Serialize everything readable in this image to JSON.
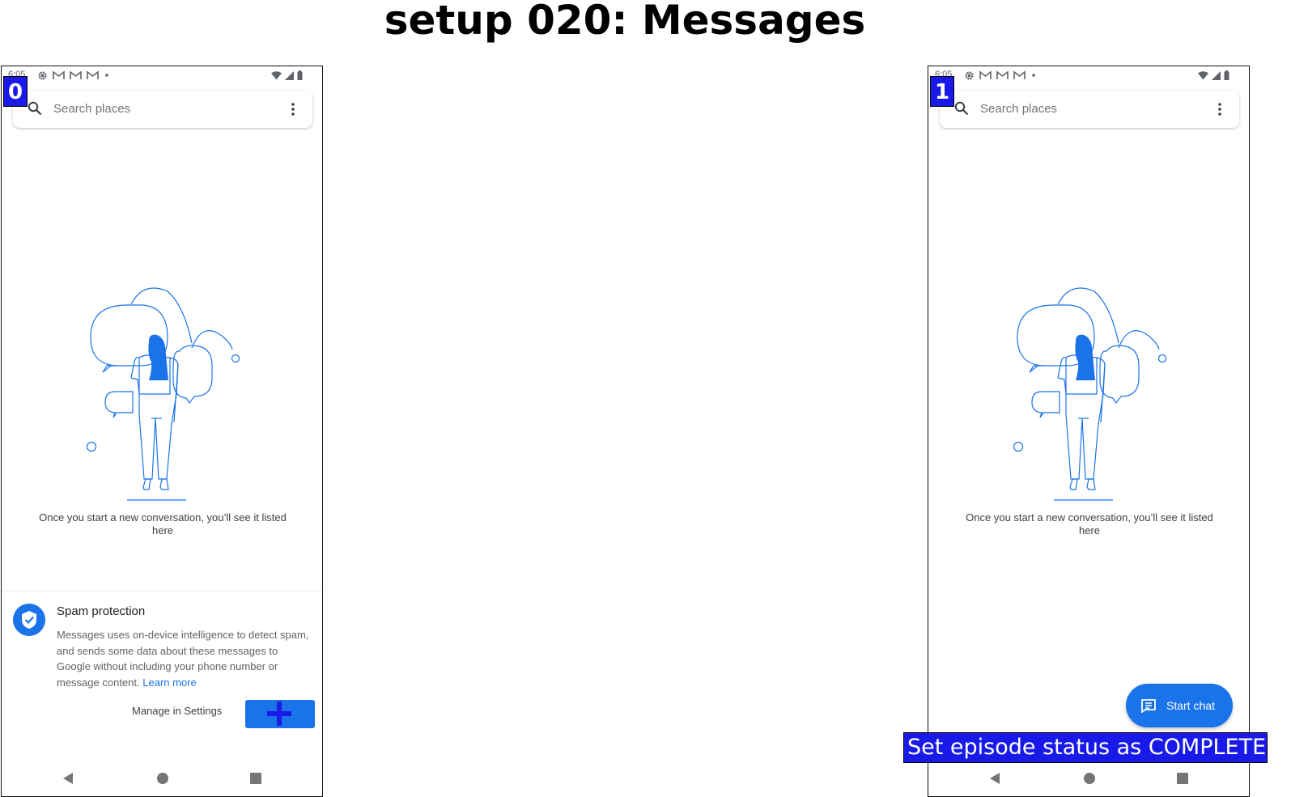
{
  "page_title": "setup 020: Messages",
  "colors": {
    "accent": "#1a73e8",
    "badge": "#1a1ae8"
  },
  "screens": [
    {
      "step_label": "0",
      "status_time": "6:05",
      "search_placeholder": "Search places",
      "empty_text": "Once you start a new conversation, you’ll see it listed here",
      "spam": {
        "title": "Spam protection",
        "body": "Messages uses on-device intelligence to detect spam, and sends some data about these messages to Google without including your phone number or message content.",
        "learn_more": "Learn more",
        "manage_label": "Manage in Settings"
      }
    },
    {
      "step_label": "1",
      "status_time": "6:05",
      "search_placeholder": "Search places",
      "empty_text": "Once you start a new conversation, you’ll see it listed here",
      "fab_label": "Start chat",
      "banner": "Set episode status as COMPLETE"
    }
  ]
}
